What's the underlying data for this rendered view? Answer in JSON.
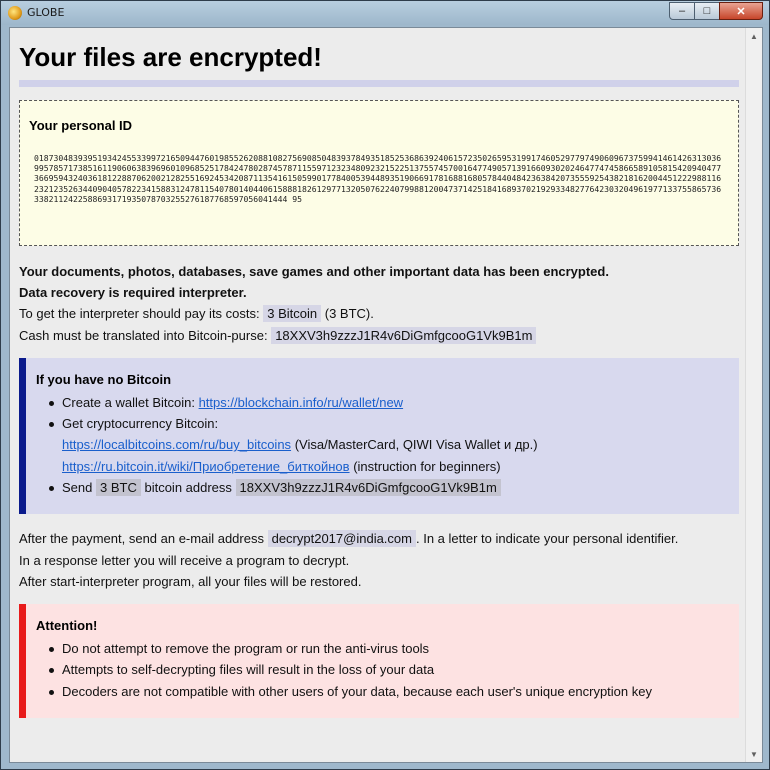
{
  "window": {
    "title": "GLOBE",
    "controls": {
      "minimize": "–",
      "maximize": "□",
      "close": "✕"
    }
  },
  "header": {
    "title": "Your files are encrypted!"
  },
  "personal_id": {
    "label": "Your personal ID",
    "value": "0187304839395193424553399721650944760198552620881082756908504839378493518525368639240615723502659531991746052977974906096737599414614263130369957857173851611906063839696010968525178424780287457871155971232348092321522513755745700164774905713916609302024647747458665891058154209404773669594324036181228870620021282551692453420871135416150599017784005394489351906691781688168057844048423638420735559254382181620044512229881162321235263440904057822341588312478115407801404406158881826129771320507622407998812004737142518416893702192933482776423032049619771337558657363382112422588693171935078703255276187768597056041444 95"
  },
  "body": {
    "line1": "Your documents, photos, databases, save games and other important data has been encrypted.",
    "line2": "Data recovery is required interpreter.",
    "cost_prefix": "To get the interpreter should pay its costs:",
    "cost_value": "3 Bitcoin",
    "cost_suffix": "(3 BTC).",
    "purse_prefix": "Cash must be translated into Bitcoin-purse:",
    "purse_value": "18XXV3h9zzzJ1R4v6DiGmfgcooG1Vk9B1m"
  },
  "no_bitcoin": {
    "title": "If you have no Bitcoin",
    "create_prefix": "Create a wallet Bitcoin:",
    "create_link": "https://blockchain.info/ru/wallet/new",
    "get_label": "Get cryptocurrency Bitcoin:",
    "link1": "https://localbitcoins.com/ru/buy_bitcoins",
    "link1_note": "(Visa/MasterCard, QIWI Visa Wallet и др.)",
    "link2": "https://ru.bitcoin.it/wiki/Приобретение_биткойнов",
    "link2_note": "(instruction for beginners)",
    "send_label": "Send",
    "send_amount": "3 BTC",
    "send_mid": "bitcoin address",
    "send_address": "18XXV3h9zzzJ1R4v6DiGmfgcooG1Vk9B1m"
  },
  "after": {
    "email_prefix": "After the payment, send an e-mail address",
    "email": "decrypt2017@india.com",
    "email_suffix": ". In a letter to indicate your personal identifier.",
    "line2": "In a response letter you will receive a program to decrypt.",
    "line3": "After start-interpreter program, all your files will be restored."
  },
  "attention": {
    "title": "Attention!",
    "items": [
      "Do not attempt to remove the program or run the anti-virus tools",
      "Attempts to self-decrypting files will result in the loss of your data",
      "Decoders are not compatible with other users of your data, because each user's unique encryption key"
    ]
  },
  "colors": {
    "no_bitcoin_bar": "#0a1a8c",
    "attention_bar": "#e81a1a",
    "link": "#1a5fcc"
  }
}
